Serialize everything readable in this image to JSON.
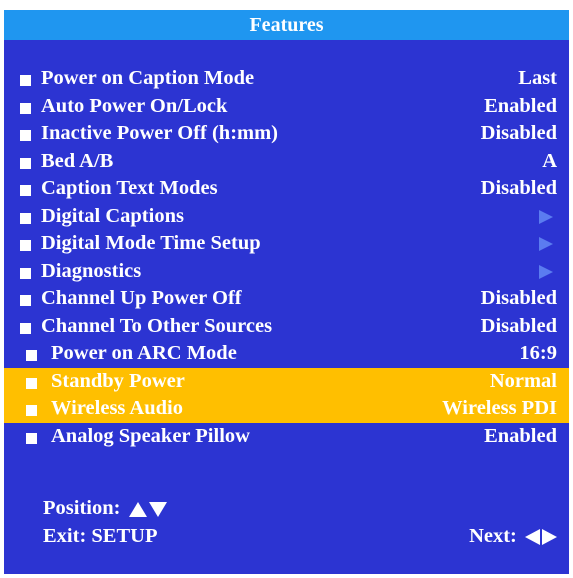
{
  "title": "Features",
  "colors": {
    "panel": "#2c34d2",
    "title_bar": "#1f96f0",
    "highlight": "#ffbf00",
    "disabled_arrow": "#5b7cf0",
    "text": "#ffffff"
  },
  "menu": {
    "items": [
      {
        "label": "Power on Caption Mode",
        "value": "Last"
      },
      {
        "label": "Auto Power On/Lock",
        "value": "Enabled"
      },
      {
        "label": "Inactive Power Off (h:mm)",
        "value": "Disabled"
      },
      {
        "label": "Bed A/B",
        "value": "A"
      },
      {
        "label": "Caption Text Modes",
        "value": "Disabled"
      },
      {
        "label": "Digital Captions",
        "icon": "right-arrow-icon"
      },
      {
        "label": "Digital Mode Time Setup",
        "icon": "right-arrow-icon"
      },
      {
        "label": "Diagnostics",
        "icon": "right-arrow-icon"
      },
      {
        "label": "Channel Up Power Off",
        "value": "Disabled"
      },
      {
        "label": "Channel To Other Sources",
        "value": "Disabled"
      },
      {
        "label": "Power on ARC Mode",
        "value": "16:9"
      },
      {
        "label": "Standby Power",
        "value": "Normal"
      },
      {
        "label": "Wireless Audio",
        "value": "Wireless PDI"
      },
      {
        "label": "Analog Speaker Pillow",
        "value": "Enabled"
      }
    ]
  },
  "footer": {
    "position_label": "Position:",
    "exit_label": "Exit: SETUP",
    "next_label": "Next:"
  }
}
